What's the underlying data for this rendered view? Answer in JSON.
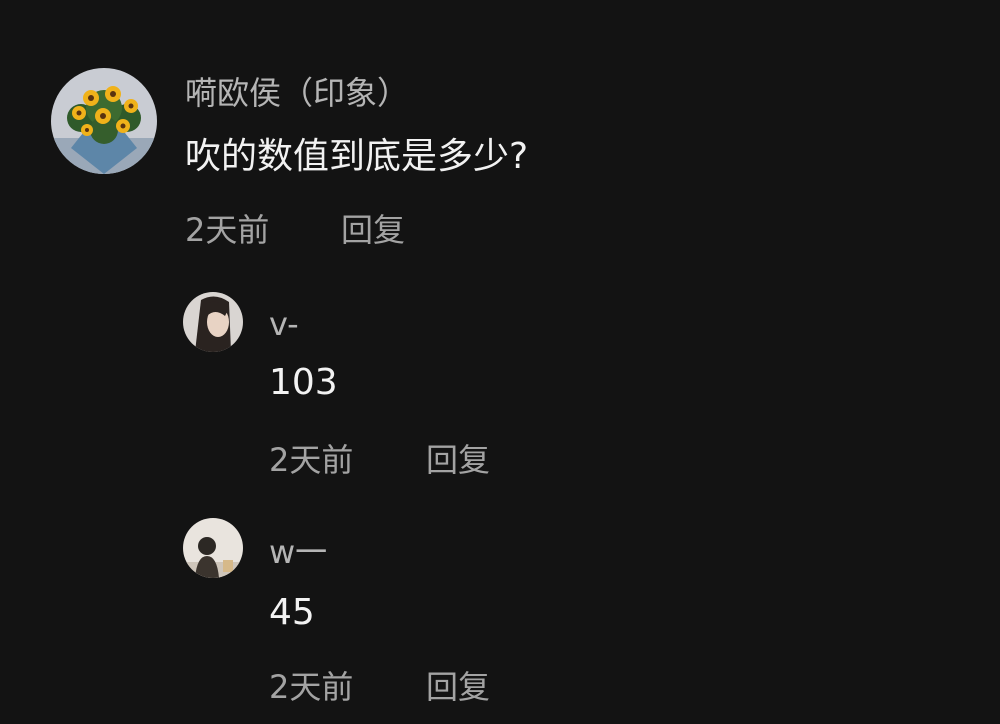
{
  "comments": [
    {
      "username": "嗬欧侯（印象）",
      "text": "吹的数值到底是多少?",
      "time": "2天前",
      "reply_label": "回复",
      "avatar_icon": "sunflower-bouquet-avatar"
    },
    {
      "username": "v-",
      "text": "103",
      "time": "2天前",
      "reply_label": "回复",
      "avatar_icon": "girl-portrait-avatar"
    },
    {
      "username": "w一",
      "text": "45",
      "time": "2天前",
      "reply_label": "回复",
      "avatar_icon": "person-silhouette-avatar"
    }
  ],
  "colors": {
    "background": "#131313",
    "text_primary": "#f2f2f2",
    "text_secondary": "#a3a3a3",
    "username": "#b5b5b5"
  }
}
